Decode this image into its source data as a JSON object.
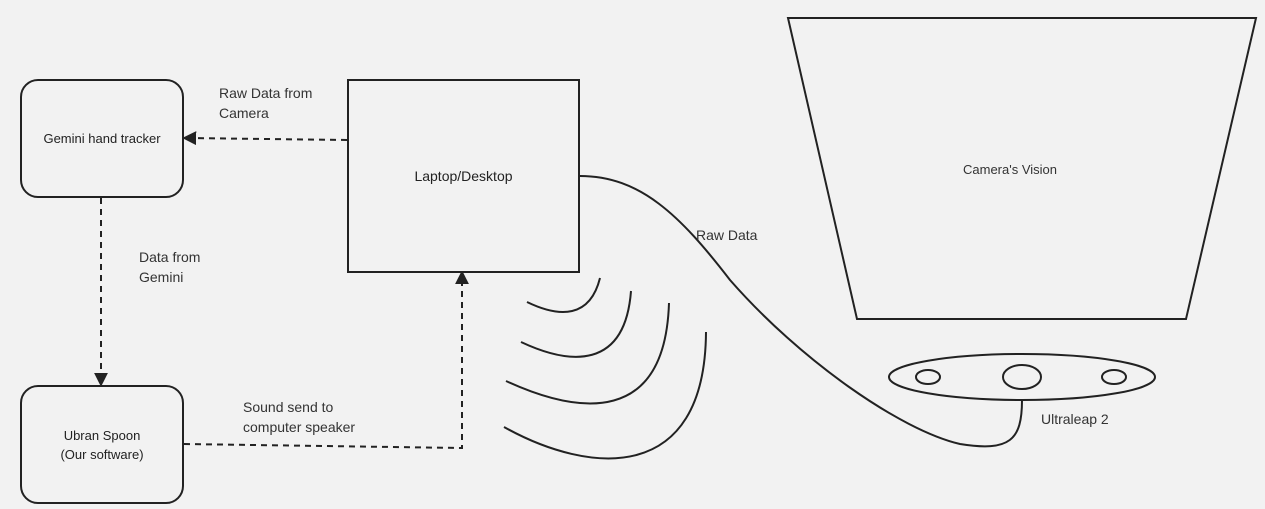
{
  "nodes": {
    "gemini": "Gemini hand tracker",
    "laptop": "Laptop/Desktop",
    "urban_line1": "Ubran Spoon",
    "urban_line2": "(Our software)",
    "camera_vision": "Camera's Vision"
  },
  "labels": {
    "raw_camera_1": "Raw Data from",
    "raw_camera_2": "Camera",
    "data_gemini_1": "Data from",
    "data_gemini_2": "Gemini",
    "sound_1": "Sound send to",
    "sound_2": "computer speaker",
    "raw_data": "Raw Data",
    "ultraleap": "Ultraleap 2"
  }
}
